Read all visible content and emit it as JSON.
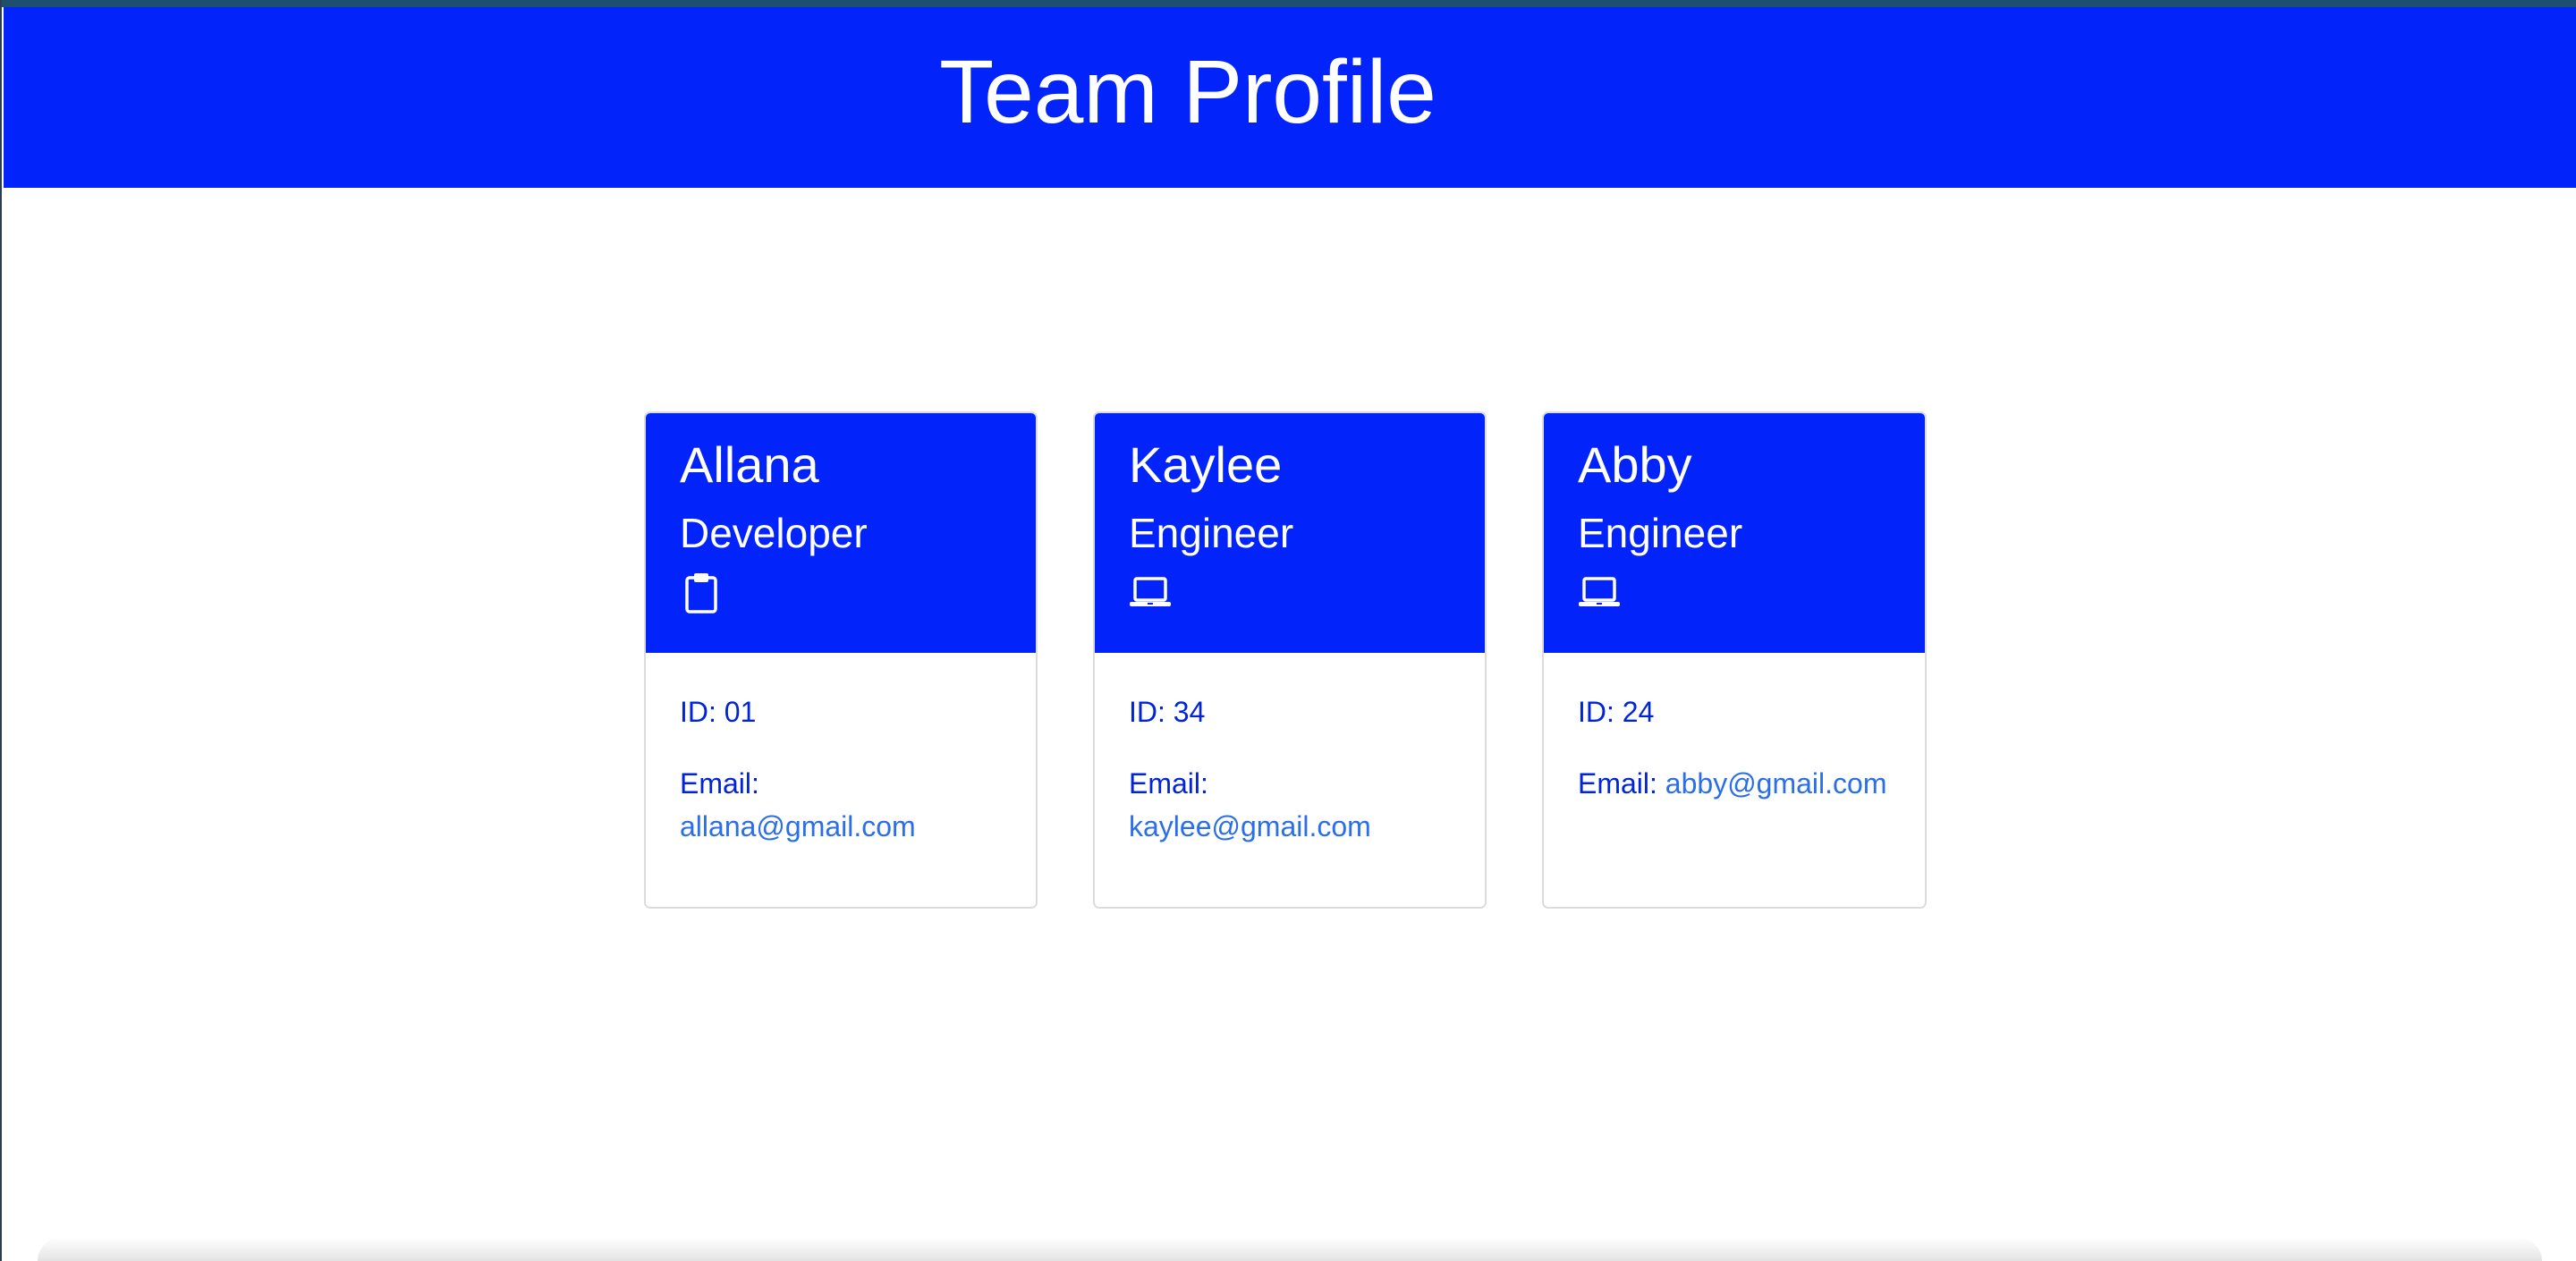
{
  "header": {
    "title": "Team Profile"
  },
  "team": [
    {
      "name": "Allana",
      "role": "Developer",
      "icon": "clipboard-icon",
      "id_label": "ID: 01",
      "email_label": "Email:",
      "email": "allana@gmail.com"
    },
    {
      "name": "Kaylee",
      "role": "Engineer",
      "icon": "laptop-icon",
      "id_label": "ID: 34",
      "email_label": "Email:",
      "email": "kaylee@gmail.com"
    },
    {
      "name": "Abby",
      "role": "Engineer",
      "icon": "laptop-icon",
      "id_label": "ID: 24",
      "email_label": "Email:",
      "email": "abby@gmail.com"
    }
  ],
  "colors": {
    "header_bg": "#0224fb",
    "text_blue": "#0224d8",
    "link_blue": "#2a6ee8"
  }
}
